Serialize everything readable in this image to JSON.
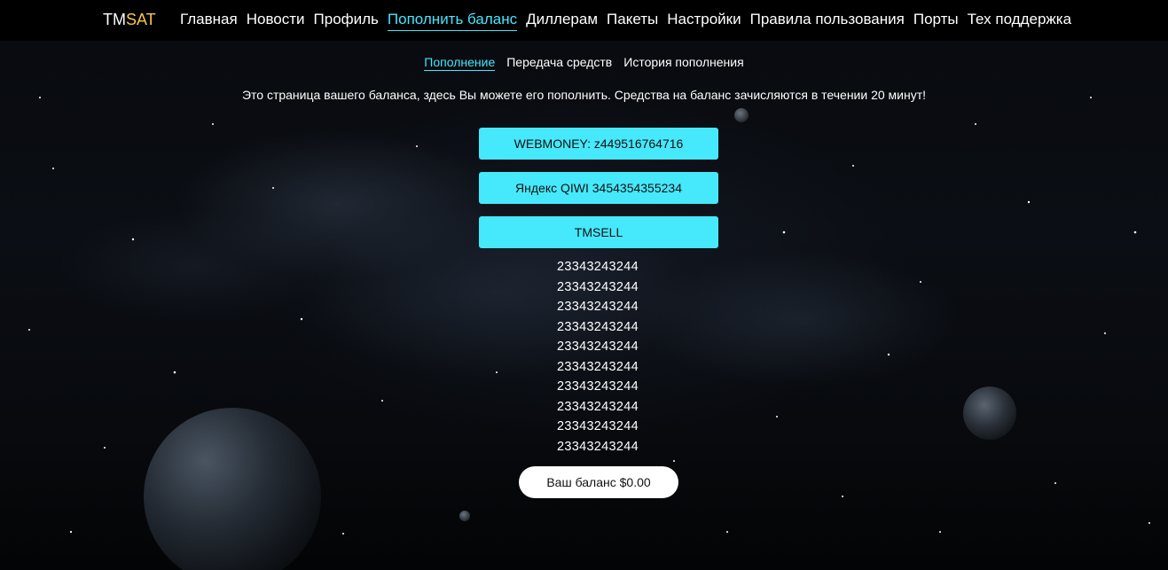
{
  "header": {
    "logo_part1": "TM",
    "logo_part2": "SAT",
    "nav": [
      {
        "label": "Главная",
        "active": false
      },
      {
        "label": "Новости",
        "active": false
      },
      {
        "label": "Профиль",
        "active": false
      },
      {
        "label": "Пополнить баланс",
        "active": true
      },
      {
        "label": "Диллерам",
        "active": false
      },
      {
        "label": "Пакеты",
        "active": false
      },
      {
        "label": "Настройки",
        "active": false
      },
      {
        "label": "Правила пользования",
        "active": false
      },
      {
        "label": "Порты",
        "active": false
      },
      {
        "label": "Тех поддержка",
        "active": false
      }
    ]
  },
  "subtabs": [
    {
      "label": "Пополнение",
      "active": true
    },
    {
      "label": "Передача средств",
      "active": false
    },
    {
      "label": "История пополнения",
      "active": false
    }
  ],
  "info_text": "Это страница вашего баланса, здесь Вы можете его пополнить. Средства на баланс зачисляются в течении 20 минут!",
  "payment_methods": [
    {
      "label": "WEBMONEY: z449516764716"
    },
    {
      "label": "Яндекс QIWI 3454354355234"
    },
    {
      "label": "TMSELL"
    }
  ],
  "codes": [
    "23343243244",
    "23343243244",
    "23343243244",
    "23343243244",
    "23343243244",
    "23343243244",
    "23343243244",
    "23343243244",
    "23343243244",
    "23343243244"
  ],
  "balance_label": "Ваш баланс $0.00",
  "colors": {
    "accent": "#45e6ff",
    "logo_accent": "#f5c84a",
    "button_bg": "#46e8fb",
    "topbar_bg": "#000000"
  }
}
